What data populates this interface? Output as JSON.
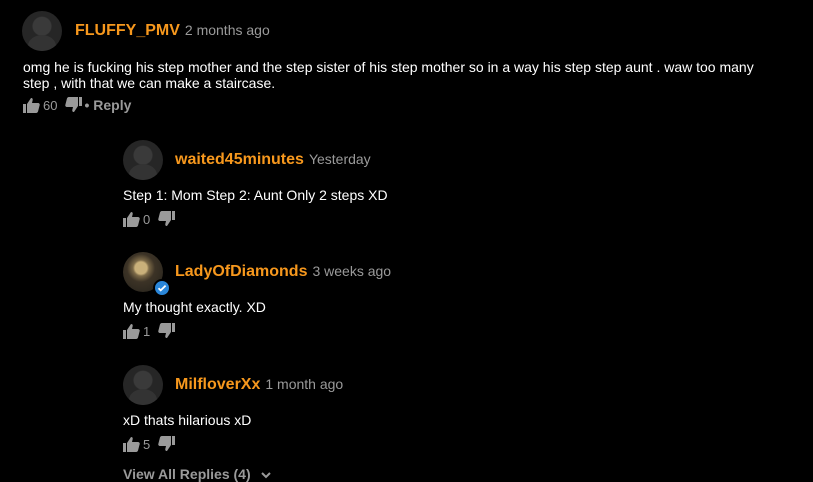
{
  "comments": [
    {
      "username": "FLUFFY_PMV",
      "time": "2 months ago",
      "text": "omg he is fucking his step mother and the step sister of his step mother so in a way his step step aunt . waw too many step , with that we can make a staircase.",
      "likes": "60",
      "reply_label": "• Reply"
    }
  ],
  "replies": [
    {
      "username": "waited45minutes",
      "time": "Yesterday",
      "text": "Step 1: Mom Step 2: Aunt Only 2 steps XD",
      "likes": "0"
    },
    {
      "username": "LadyOfDiamonds",
      "time": "3 weeks ago",
      "text": "My thought exactly. XD",
      "likes": "1",
      "verified": true
    },
    {
      "username": "MilfloverXx",
      "time": "1 month ago",
      "text": "xD thats hilarious xD",
      "likes": "5"
    }
  ],
  "view_all_replies": "View All Replies (4)",
  "icons": {
    "like": "thumbs-up-icon",
    "dislike": "thumbs-down-icon",
    "verified": "verified-check-icon",
    "chevron": "chevron-down-icon"
  },
  "colors": {
    "username": "#f7981d",
    "muted": "#9a9a9a",
    "background": "#000000",
    "verified": "#2a86d9"
  }
}
